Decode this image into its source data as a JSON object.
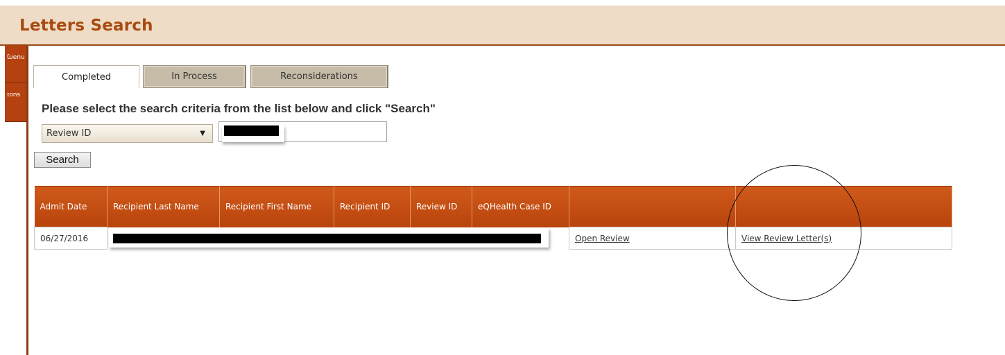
{
  "header": {
    "title": "Letters Search"
  },
  "left_rail": {
    "tabs": [
      "nuəɱ",
      "suoɪ"
    ]
  },
  "tabs": [
    {
      "label": "Completed",
      "active": true
    },
    {
      "label": "In Process",
      "active": false
    },
    {
      "label": "Reconsiderations",
      "active": false
    }
  ],
  "search": {
    "instructions": "Please select the search criteria from the list below and click \"Search\"",
    "criteria_selected": "Review ID",
    "input_value": "",
    "button_label": "Search"
  },
  "table": {
    "columns": [
      "Admit Date",
      "Recipient Last Name",
      "Recipient First Name",
      "Recipient ID",
      "Review ID",
      "eQHealth Case ID",
      "",
      ""
    ],
    "rows": [
      {
        "admit_date": "06/27/2016",
        "open_review": "Open Review",
        "view_letters": "View Review Letter(s)"
      }
    ]
  },
  "colors": {
    "accent": "#b8430c",
    "header_bg": "#efdcc6",
    "title": "#a84a10"
  }
}
